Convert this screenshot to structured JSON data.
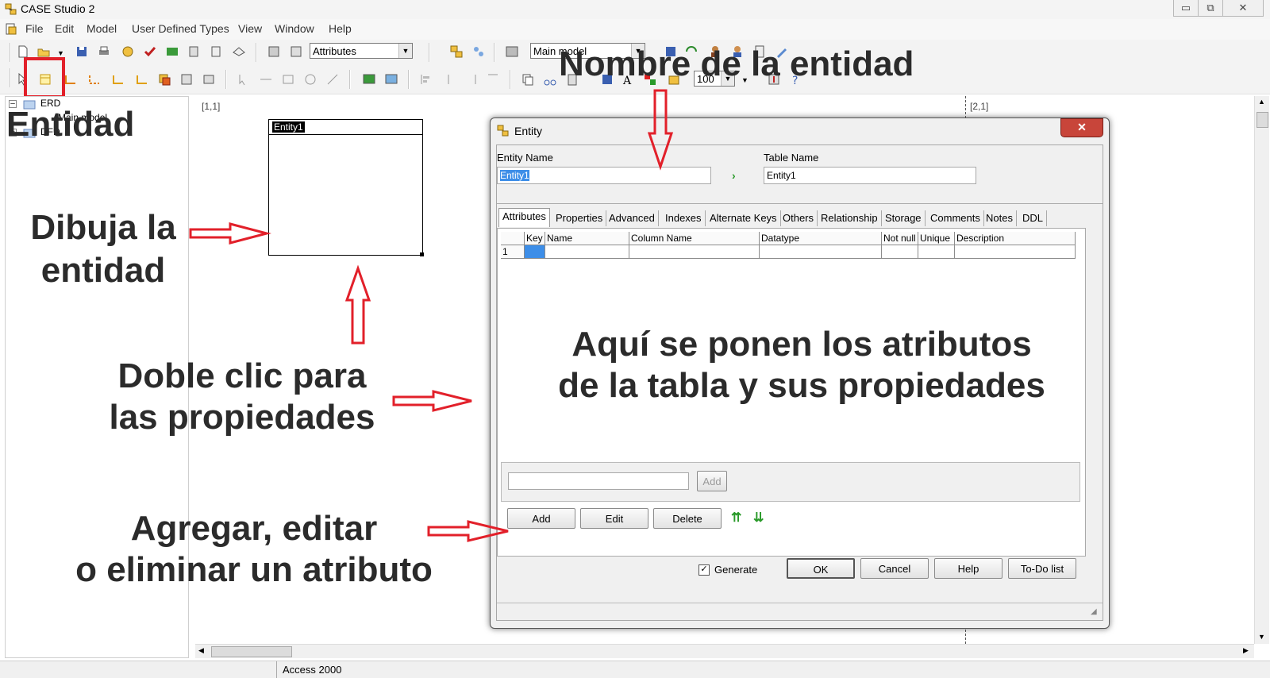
{
  "window": {
    "title": "CASE Studio 2",
    "min": "▭",
    "max": "⧉",
    "close": "✕"
  },
  "menu": [
    "File",
    "Edit",
    "Model",
    "User Defined Types",
    "View",
    "Window",
    "Help"
  ],
  "mdi": {
    "min": "–",
    "max": "⧉",
    "close": "✕"
  },
  "toolbar": {
    "combo_attributes": "Attributes",
    "combo_model": "Main model",
    "zoom": "100"
  },
  "tree": {
    "items": [
      "ERD",
      "Main model",
      "DFD"
    ]
  },
  "canvas": {
    "page_left": "[1,1]",
    "page_right": "[2,1]",
    "entity_label": "Entity1"
  },
  "dialog": {
    "title": "Entity",
    "close": "✕",
    "entity_name_label": "Entity Name",
    "entity_name_value": "Entity1",
    "table_name_label": "Table Name",
    "table_name_value": "Entity1",
    "tabs": [
      "Attributes",
      "Properties",
      "Advanced",
      "Indexes",
      "Alternate Keys",
      "Others",
      "Relationship",
      "Storage",
      "Comments",
      "Notes",
      "DDL"
    ],
    "columns": [
      "",
      "Key",
      "Name",
      "Column Name",
      "Datatype",
      "Not null",
      "Unique",
      "Description"
    ],
    "row_number": "1",
    "small_add": "Add",
    "add": "Add",
    "edit": "Edit",
    "delete": "Delete",
    "generate": "Generate",
    "ok": "OK",
    "cancel": "Cancel",
    "help": "Help",
    "todo": "To-Do list"
  },
  "statusbar": {
    "db": "Access 2000"
  },
  "annotations": {
    "entidad": "Entidad",
    "nombre": "Nombre de la entidad",
    "dibuja_1": "Dibuja la",
    "dibuja_2": "entidad",
    "doble_1": "Doble clic para",
    "doble_2": "las propiedades",
    "agregar_1": "Agregar, editar",
    "agregar_2": "o eliminar un atributo",
    "aqui_1": "Aquí se ponen los atributos",
    "aqui_2": "de la tabla y sus propiedades"
  },
  "colors": {
    "annotation_red": "#e2202a",
    "annotation_text": "#2b2b2b",
    "dialog_close": "#c8453a",
    "grid_select": "#3d8ee8"
  }
}
